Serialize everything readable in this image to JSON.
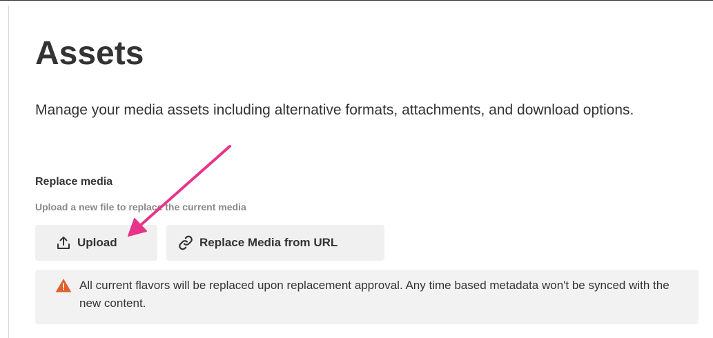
{
  "page": {
    "title": "Assets",
    "description": "Manage your media assets including alternative formats, attachments, and download options."
  },
  "replace_media": {
    "title": "Replace media",
    "subtitle": "Upload a new file to replace the current media",
    "upload_button": {
      "label": "Upload",
      "icon": "upload-icon"
    },
    "url_button": {
      "label": "Replace Media from URL",
      "icon": "link-icon"
    }
  },
  "alert": {
    "icon": "warning-icon",
    "text": "All current flavors will be replaced upon replacement approval. Any time based metadata won't be synced with the new content."
  },
  "colors": {
    "text": "#333333",
    "muted": "#888888",
    "button_bg": "#f0f0f0",
    "alert_bg": "#f2f2f2",
    "warning": "#e1602b",
    "annotation": "#e8338a"
  }
}
